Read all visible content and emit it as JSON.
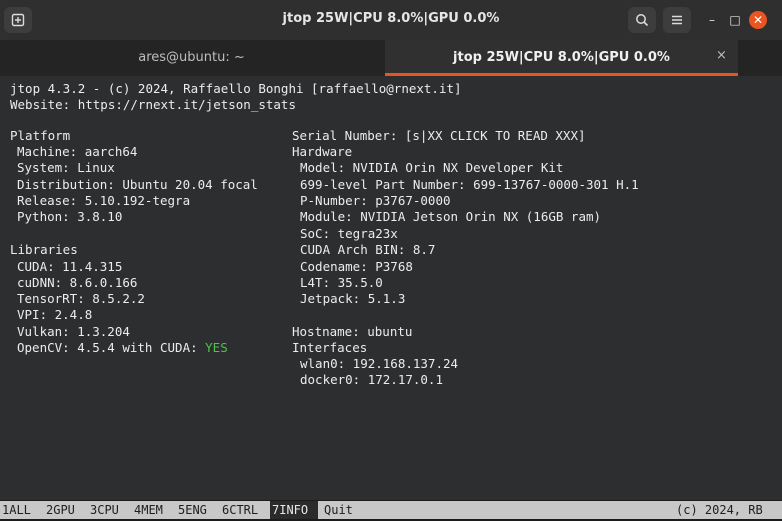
{
  "window": {
    "title": "jtop 25W|CPU 8.0%|GPU 0.0%",
    "new_tab_icon": "new-tab-icon",
    "search_icon": "search-icon",
    "menu_icon": "hamburger-menu-icon",
    "minimize": "–",
    "maximize": "□",
    "close": "✕"
  },
  "tabs": [
    {
      "label": "ares@ubuntu: ~",
      "active": false
    },
    {
      "label": "jtop 25W|CPU 8.0%|GPU 0.0%",
      "active": true,
      "close": "×"
    }
  ],
  "tab_menu": "▾",
  "accent": "#e95420",
  "header": {
    "line1": "jtop 4.3.2 - (c) 2024, Raffaello Bonghi [raffaello@rnext.it]",
    "line2": "Website: https://rnext.it/jetson_stats"
  },
  "platform": {
    "title": "Platform",
    "items": [
      "Machine: aarch64",
      "System: Linux",
      "Distribution: Ubuntu 20.04 focal",
      "Release: 5.10.192-tegra",
      "Python: 3.8.10"
    ]
  },
  "libraries": {
    "title": "Libraries",
    "items": [
      "CUDA: 11.4.315",
      "cuDNN: 8.6.0.166",
      "TensorRT: 8.5.2.2",
      "VPI: 2.4.8",
      "Vulkan: 1.3.204"
    ],
    "opencv_prefix": "OpenCV: 4.5.4 with CUDA: ",
    "opencv_cuda": "YES"
  },
  "serial": "Serial Number: [s|XX CLICK TO READ XXX]",
  "hardware": {
    "title": "Hardware",
    "items": [
      "Model: NVIDIA Orin NX Developer Kit",
      "699-level Part Number: 699-13767-0000-301 H.1",
      "P-Number: p3767-0000",
      "Module: NVIDIA Jetson Orin NX (16GB ram)",
      "SoC: tegra23x",
      "CUDA Arch BIN: 8.7",
      "Codename: P3768",
      "L4T: 35.5.0",
      "Jetpack: 5.1.3"
    ]
  },
  "hostname": "Hostname: ubuntu",
  "interfaces": {
    "title": "Interfaces",
    "items": [
      "wlan0: 192.168.137.24",
      "docker0: 172.17.0.1"
    ]
  },
  "bottom_bar": {
    "keys": [
      "1ALL",
      "2GPU",
      "3CPU",
      "4MEM",
      "5ENG",
      "6CTRL",
      "7INFO",
      "Quit"
    ],
    "selected": "7INFO",
    "copyright": "(c) 2024, RB"
  },
  "colors": {
    "ok_green": "#50c24a",
    "background": "#2c2e2f"
  }
}
